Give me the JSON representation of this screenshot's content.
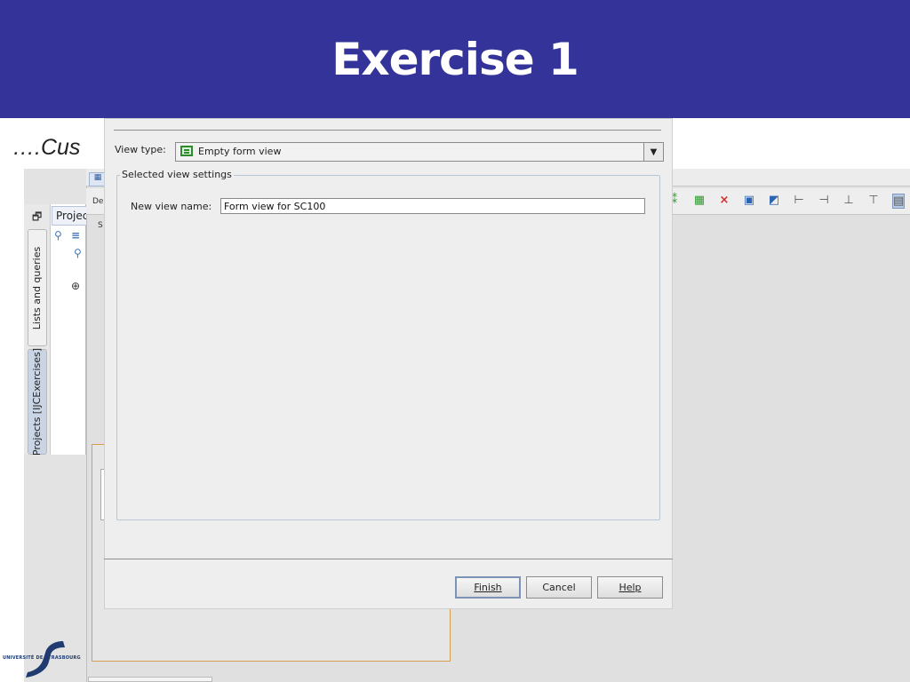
{
  "slide": {
    "title": "Exercise 1",
    "subtitle": "….Cus"
  },
  "ide": {
    "project_tab_label": "Projec",
    "side_tab_lists": "Lists and queries",
    "side_tab_projects": "Projects [IJCExercises]",
    "editor_label_de": "De",
    "editor_label_s": "S"
  },
  "dialog": {
    "view_type_label": "View type:",
    "view_type_value": "Empty form view",
    "settings_group_title": "Selected view settings",
    "new_view_name_label": "New view name:",
    "new_view_name_value": "Form view for SC100",
    "buttons": {
      "finish": "Finish",
      "cancel": "Cancel",
      "help": "Help"
    }
  },
  "logo": {
    "text": "UNIVERSITÉ DE STRASBOURG"
  },
  "colors": {
    "header_bg": "#343399",
    "header_text": "#ffffff",
    "dialog_bg": "#eeeeee",
    "designer_border": "#d59e53"
  }
}
